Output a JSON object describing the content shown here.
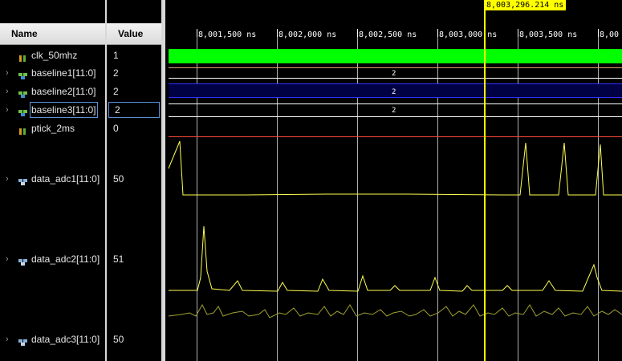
{
  "headers": {
    "name": "Name",
    "value": "Value"
  },
  "signals": [
    {
      "name": "clk_50mhz",
      "value": "1",
      "type": "bit",
      "expandable": false
    },
    {
      "name": "baseline1[11:0]",
      "value": "2",
      "type": "bus",
      "expandable": true
    },
    {
      "name": "baseline2[11:0]",
      "value": "2",
      "type": "bus",
      "expandable": true
    },
    {
      "name": "baseline3[11:0]",
      "value": "2",
      "type": "bus",
      "expandable": true
    },
    {
      "name": "ptick_2ms",
      "value": "0",
      "type": "bit",
      "expandable": false
    },
    {
      "name": "data_adc1[11:0]",
      "value": "50",
      "type": "analog",
      "expandable": true
    },
    {
      "name": "data_adc2[11:0]",
      "value": "51",
      "type": "analog",
      "expandable": true
    },
    {
      "name": "data_adc3[11:0]",
      "value": "50",
      "type": "analog",
      "expandable": true
    }
  ],
  "timeline": {
    "ticks": [
      "8,001,500 ns",
      "8,002,000 ns",
      "8,002,500 ns",
      "8,003,000 ns",
      "8,003,500 ns",
      "8,00"
    ],
    "cursor_label": "8,003,296.214 ns"
  },
  "bus_values": {
    "baseline1": "2",
    "baseline2": "2",
    "baseline3": "2"
  },
  "colors": {
    "clock": "#00ff00",
    "ptick": "#ff4a3a",
    "baseline2": "#3030ff",
    "adc_trace": "#ffff50",
    "adc3_trace": "#a0a030",
    "cursor": "#ffff00",
    "grid": "#b0b0b0"
  }
}
